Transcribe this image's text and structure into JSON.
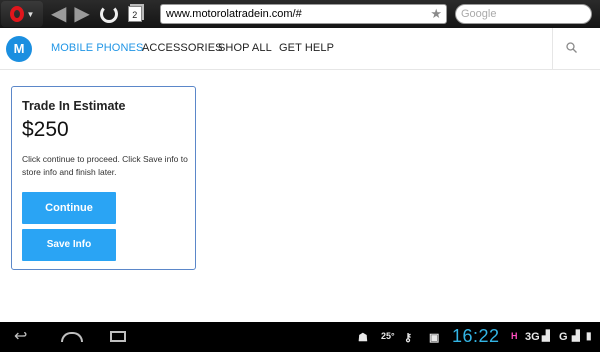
{
  "browser": {
    "tabs_count": "2",
    "url": "www.motorolatradein.com/#",
    "search_placeholder": "Google"
  },
  "site": {
    "logo": "M",
    "nav": [
      "MOBILE PHONES",
      "ACCESSORIES",
      "SHOP ALL",
      "GET HELP"
    ],
    "active_nav": "MOBILE PHONES"
  },
  "card": {
    "title": "Trade In Estimate",
    "price": "$250",
    "description": "Click continue to proceed. Click Save info to store info and finish later.",
    "continue_label": "Continue",
    "save_label": "Save Info"
  },
  "system_bar": {
    "temperature": "25°",
    "clock": "16:22",
    "network_h": "H",
    "network_3g": "3G",
    "network_g": "G"
  },
  "colors": {
    "accent": "#2aa4f4",
    "nav_active": "#2196e6",
    "clock": "#33b5e5",
    "card_border": "#5b87c9"
  }
}
